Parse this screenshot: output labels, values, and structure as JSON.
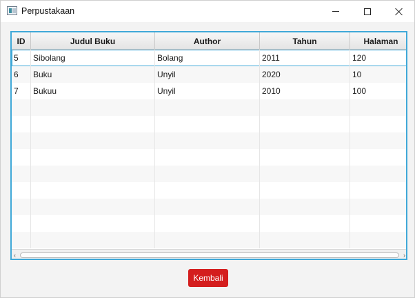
{
  "window": {
    "title": "Perpustakaan"
  },
  "table": {
    "columns": [
      "ID",
      "Judul Buku",
      "Author",
      "Tahun",
      "Halaman"
    ],
    "rows": [
      [
        "5",
        "Sibolang",
        "Bolang",
        "2011",
        "120"
      ],
      [
        "6",
        "Buku",
        "Unyil",
        "2020",
        "10"
      ],
      [
        "7",
        "Bukuu",
        "Unyil",
        "2010",
        "100"
      ]
    ],
    "selected_row": 0
  },
  "actions": {
    "kembali_label": "Kembali"
  },
  "icons": {
    "app": "window-app-icon",
    "minimize": "minimize-icon",
    "maximize": "maximize-icon",
    "close": "close-icon",
    "scroll_left": "chevron-left-icon",
    "scroll_right": "chevron-right-icon"
  },
  "colors": {
    "accent": "#3fa8d8",
    "button": "#d41e1e",
    "window_bg": "#f3f3f3"
  }
}
